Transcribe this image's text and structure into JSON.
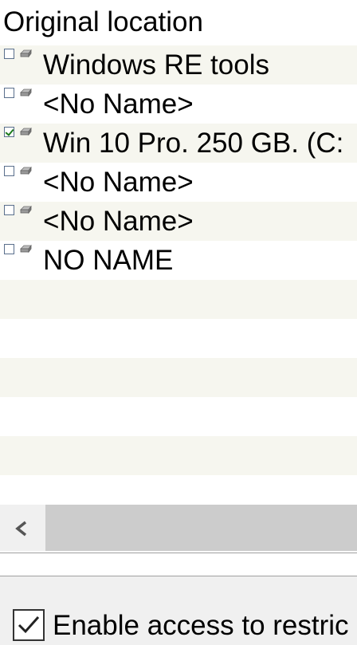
{
  "header": {
    "column_label": "Original location"
  },
  "rows": [
    {
      "label": "Windows RE tools",
      "checked": false
    },
    {
      "label": "<No Name>",
      "checked": false
    },
    {
      "label": "Win 10 Pro. 250 GB. (C:",
      "checked": true
    },
    {
      "label": "<No Name>",
      "checked": false
    },
    {
      "label": "<No Name>",
      "checked": false
    },
    {
      "label": "NO NAME",
      "checked": false
    }
  ],
  "row_icon": "drive-icon",
  "scrollbar": {
    "left_icon": "chevron-left-icon"
  },
  "footer": {
    "option_label": "Enable access to restric",
    "option_checked": true
  }
}
